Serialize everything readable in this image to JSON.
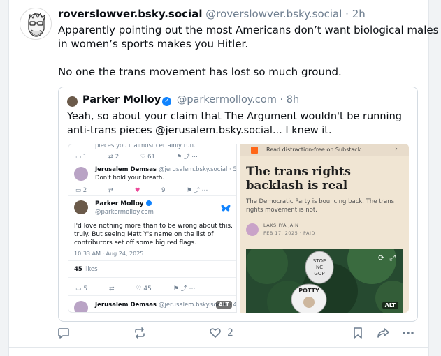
{
  "post": {
    "author_name": "roverslowver.bsky.social",
    "author_handle": "@roverslowver.bsky.social",
    "separator": "·",
    "time": "2h",
    "text_line1": "Apparently pointing out the most Americans don’t want biological males",
    "text_line2": "in women’s sports makes you Hitler.",
    "text_line3": "No one the trans movement has lost so much ground.",
    "like_count": "2"
  },
  "quote": {
    "author_name": "Parker Molloy",
    "author_handle": "@parkermolloy.com",
    "separator": "·",
    "time": "8h",
    "text_line1": "Yeah, so about your claim that The Argument wouldn't be running",
    "text_line2": "anti-trans pieces @jerusalem.bsky.social... I knew it.",
    "image_left": {
      "top_snippet": "pieces you'll almost certainly run.",
      "row1": [
        "1",
        "2",
        "61"
      ],
      "reply_name": "Jerusalem Demsas",
      "reply_handle": "@jerusalem.bsky.social · 5mo",
      "reply_text": "Don't hold your breath.",
      "row2": [
        "2",
        "",
        "9"
      ],
      "main_name": "Parker Molloy",
      "main_handle": "@parkermolloy.com",
      "main_text_1": "I'd love nothing more than to be wrong about this,",
      "main_text_2": "truly. But seeing Matt Y's name on the list of",
      "main_text_3": "contributors set off some big red flags.",
      "timestamp": "10:33 AM · Aug 24, 2025",
      "likes_num": "45",
      "likes_word": "likes",
      "row3": [
        "5",
        "",
        "45"
      ],
      "bottom_name": "Jerusalem Demsas",
      "bottom_handle": "@jerusalem.bsky.social · 4",
      "alt": "ALT"
    },
    "image_right": {
      "banner": "Read distraction-free on Substack",
      "title": "The trans rights backlash is real",
      "subtitle": "The Democratic Party is bouncing back. The trans rights movement is not.",
      "author": "LAKSHYA JAIN",
      "date": "FEB 17, 2025 · PAID",
      "sign_text_1": "STOP",
      "sign_text_2": "NC",
      "sign_text_3": "GOP",
      "sign_text_4": "POTTY",
      "alt": "ALT"
    }
  },
  "colors": {
    "verified": "#1083fe",
    "butterfly": "#1083fe",
    "substack": "#ff6719",
    "muted": "#6f7f90"
  }
}
